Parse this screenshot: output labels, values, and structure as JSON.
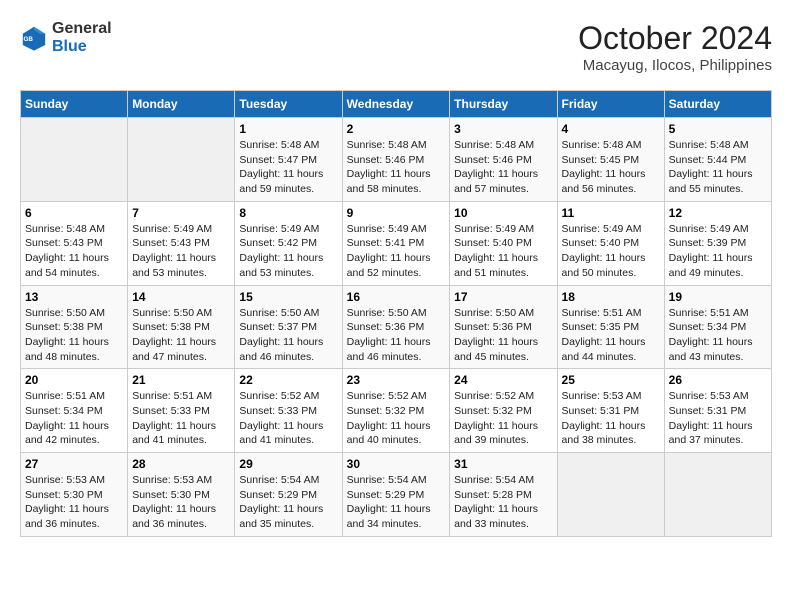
{
  "header": {
    "logo_line1": "General",
    "logo_line2": "Blue",
    "title": "October 2024",
    "subtitle": "Macayug, Ilocos, Philippines"
  },
  "calendar": {
    "days_of_week": [
      "Sunday",
      "Monday",
      "Tuesday",
      "Wednesday",
      "Thursday",
      "Friday",
      "Saturday"
    ],
    "weeks": [
      [
        {
          "num": "",
          "detail": ""
        },
        {
          "num": "",
          "detail": ""
        },
        {
          "num": "1",
          "detail": "Sunrise: 5:48 AM\nSunset: 5:47 PM\nDaylight: 11 hours and 59 minutes."
        },
        {
          "num": "2",
          "detail": "Sunrise: 5:48 AM\nSunset: 5:46 PM\nDaylight: 11 hours and 58 minutes."
        },
        {
          "num": "3",
          "detail": "Sunrise: 5:48 AM\nSunset: 5:46 PM\nDaylight: 11 hours and 57 minutes."
        },
        {
          "num": "4",
          "detail": "Sunrise: 5:48 AM\nSunset: 5:45 PM\nDaylight: 11 hours and 56 minutes."
        },
        {
          "num": "5",
          "detail": "Sunrise: 5:48 AM\nSunset: 5:44 PM\nDaylight: 11 hours and 55 minutes."
        }
      ],
      [
        {
          "num": "6",
          "detail": "Sunrise: 5:48 AM\nSunset: 5:43 PM\nDaylight: 11 hours and 54 minutes."
        },
        {
          "num": "7",
          "detail": "Sunrise: 5:49 AM\nSunset: 5:43 PM\nDaylight: 11 hours and 53 minutes."
        },
        {
          "num": "8",
          "detail": "Sunrise: 5:49 AM\nSunset: 5:42 PM\nDaylight: 11 hours and 53 minutes."
        },
        {
          "num": "9",
          "detail": "Sunrise: 5:49 AM\nSunset: 5:41 PM\nDaylight: 11 hours and 52 minutes."
        },
        {
          "num": "10",
          "detail": "Sunrise: 5:49 AM\nSunset: 5:40 PM\nDaylight: 11 hours and 51 minutes."
        },
        {
          "num": "11",
          "detail": "Sunrise: 5:49 AM\nSunset: 5:40 PM\nDaylight: 11 hours and 50 minutes."
        },
        {
          "num": "12",
          "detail": "Sunrise: 5:49 AM\nSunset: 5:39 PM\nDaylight: 11 hours and 49 minutes."
        }
      ],
      [
        {
          "num": "13",
          "detail": "Sunrise: 5:50 AM\nSunset: 5:38 PM\nDaylight: 11 hours and 48 minutes."
        },
        {
          "num": "14",
          "detail": "Sunrise: 5:50 AM\nSunset: 5:38 PM\nDaylight: 11 hours and 47 minutes."
        },
        {
          "num": "15",
          "detail": "Sunrise: 5:50 AM\nSunset: 5:37 PM\nDaylight: 11 hours and 46 minutes."
        },
        {
          "num": "16",
          "detail": "Sunrise: 5:50 AM\nSunset: 5:36 PM\nDaylight: 11 hours and 46 minutes."
        },
        {
          "num": "17",
          "detail": "Sunrise: 5:50 AM\nSunset: 5:36 PM\nDaylight: 11 hours and 45 minutes."
        },
        {
          "num": "18",
          "detail": "Sunrise: 5:51 AM\nSunset: 5:35 PM\nDaylight: 11 hours and 44 minutes."
        },
        {
          "num": "19",
          "detail": "Sunrise: 5:51 AM\nSunset: 5:34 PM\nDaylight: 11 hours and 43 minutes."
        }
      ],
      [
        {
          "num": "20",
          "detail": "Sunrise: 5:51 AM\nSunset: 5:34 PM\nDaylight: 11 hours and 42 minutes."
        },
        {
          "num": "21",
          "detail": "Sunrise: 5:51 AM\nSunset: 5:33 PM\nDaylight: 11 hours and 41 minutes."
        },
        {
          "num": "22",
          "detail": "Sunrise: 5:52 AM\nSunset: 5:33 PM\nDaylight: 11 hours and 41 minutes."
        },
        {
          "num": "23",
          "detail": "Sunrise: 5:52 AM\nSunset: 5:32 PM\nDaylight: 11 hours and 40 minutes."
        },
        {
          "num": "24",
          "detail": "Sunrise: 5:52 AM\nSunset: 5:32 PM\nDaylight: 11 hours and 39 minutes."
        },
        {
          "num": "25",
          "detail": "Sunrise: 5:53 AM\nSunset: 5:31 PM\nDaylight: 11 hours and 38 minutes."
        },
        {
          "num": "26",
          "detail": "Sunrise: 5:53 AM\nSunset: 5:31 PM\nDaylight: 11 hours and 37 minutes."
        }
      ],
      [
        {
          "num": "27",
          "detail": "Sunrise: 5:53 AM\nSunset: 5:30 PM\nDaylight: 11 hours and 36 minutes."
        },
        {
          "num": "28",
          "detail": "Sunrise: 5:53 AM\nSunset: 5:30 PM\nDaylight: 11 hours and 36 minutes."
        },
        {
          "num": "29",
          "detail": "Sunrise: 5:54 AM\nSunset: 5:29 PM\nDaylight: 11 hours and 35 minutes."
        },
        {
          "num": "30",
          "detail": "Sunrise: 5:54 AM\nSunset: 5:29 PM\nDaylight: 11 hours and 34 minutes."
        },
        {
          "num": "31",
          "detail": "Sunrise: 5:54 AM\nSunset: 5:28 PM\nDaylight: 11 hours and 33 minutes."
        },
        {
          "num": "",
          "detail": ""
        },
        {
          "num": "",
          "detail": ""
        }
      ]
    ]
  }
}
